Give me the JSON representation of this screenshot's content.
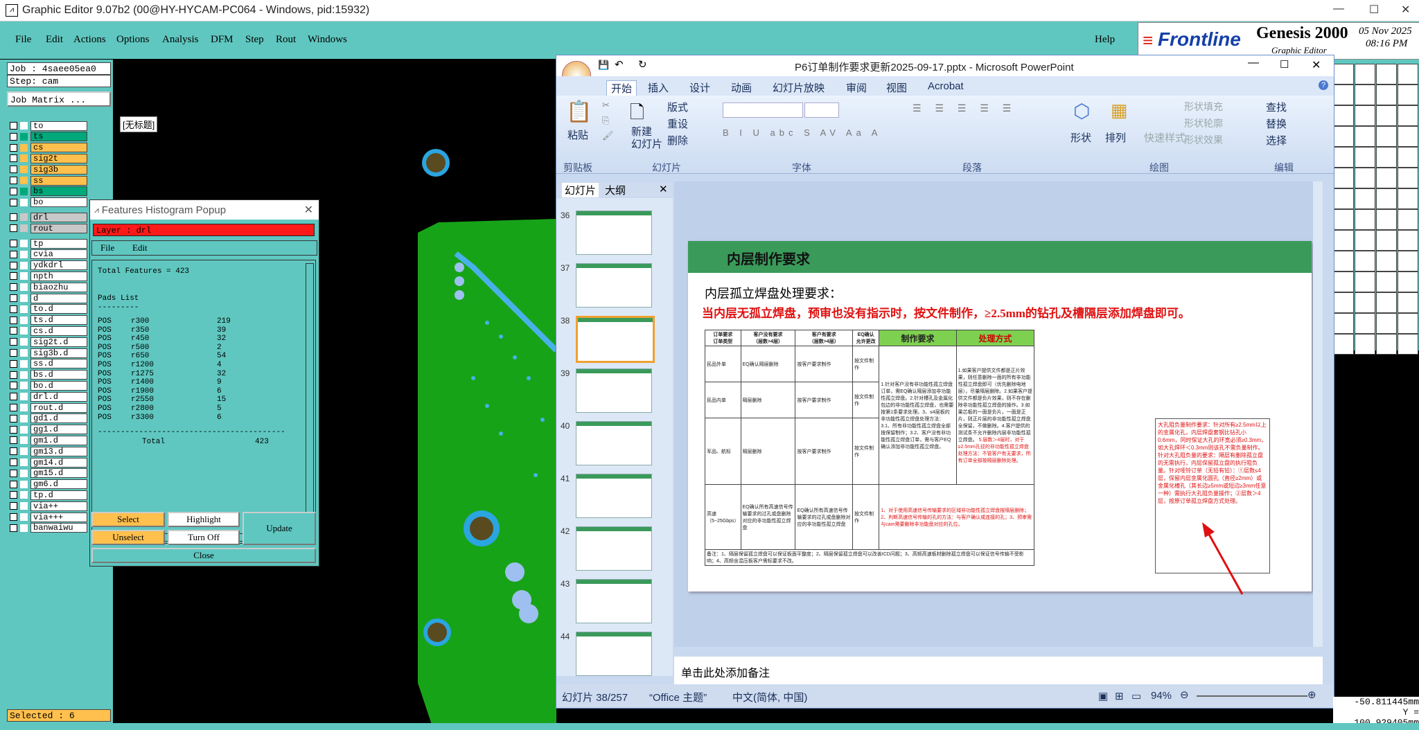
{
  "app": {
    "title": "Graphic Editor 9.07b2 (00@HY-HYCAM-PC064 - Windows, pid:15932)",
    "menus": [
      "File",
      "Edit",
      "Actions",
      "Options",
      "Analysis",
      "DFM",
      "Step",
      "Rout",
      "Windows"
    ],
    "help": "Help",
    "logo": {
      "brand": "Frontline",
      "product": "Genesis 2000",
      "subtitle": "Graphic Editor",
      "date": "05 Nov 2025",
      "time": "08:16 PM"
    }
  },
  "left_panel": {
    "job": "Job : 4saee05ea0",
    "step": "Step: cam",
    "job_matrix": "Job Matrix ...",
    "layers": [
      {
        "name": "to",
        "color": "#ffffff"
      },
      {
        "name": "ts",
        "color": "#00a87a"
      },
      {
        "name": "cs",
        "color": "#ffc04d"
      },
      {
        "name": "sig2t",
        "color": "#ffc04d"
      },
      {
        "name": "sig3b",
        "color": "#ffc04d"
      },
      {
        "name": "ss",
        "color": "#ffc04d"
      },
      {
        "name": "bs",
        "color": "#00a87a"
      },
      {
        "name": "bo",
        "color": "#ffffff"
      },
      {
        "name": "drl",
        "color": "#c8c8c8"
      },
      {
        "name": "rout",
        "color": "#c8c8c8"
      },
      {
        "name": "tp",
        "color": "#ffffff"
      },
      {
        "name": "cvia",
        "color": "#ffffff"
      },
      {
        "name": "ydkdrl",
        "color": "#ffffff"
      },
      {
        "name": "npth",
        "color": "#ffffff"
      },
      {
        "name": "biaozhu",
        "color": "#ffffff"
      },
      {
        "name": "d",
        "color": "#ffffff"
      },
      {
        "name": "to.d",
        "color": "#ffffff"
      },
      {
        "name": "ts.d",
        "color": "#ffffff"
      },
      {
        "name": "cs.d",
        "color": "#ffffff"
      },
      {
        "name": "sig2t.d",
        "color": "#ffffff"
      },
      {
        "name": "sig3b.d",
        "color": "#ffffff"
      },
      {
        "name": "ss.d",
        "color": "#ffffff"
      },
      {
        "name": "bs.d",
        "color": "#ffffff"
      },
      {
        "name": "bo.d",
        "color": "#ffffff"
      },
      {
        "name": "drl.d",
        "color": "#ffffff"
      },
      {
        "name": "rout.d",
        "color": "#ffffff"
      },
      {
        "name": "gd1.d",
        "color": "#ffffff"
      },
      {
        "name": "gg1.d",
        "color": "#ffffff"
      },
      {
        "name": "gm1.d",
        "color": "#ffffff"
      },
      {
        "name": "gm13.d",
        "color": "#ffffff"
      },
      {
        "name": "gm14.d",
        "color": "#ffffff"
      },
      {
        "name": "gm15.d",
        "color": "#ffffff"
      },
      {
        "name": "gm6.d",
        "color": "#ffffff"
      },
      {
        "name": "tp.d",
        "color": "#ffffff"
      },
      {
        "name": "via++",
        "color": "#ffffff"
      },
      {
        "name": "via+++",
        "color": "#ffffff"
      },
      {
        "name": "banwaiwu",
        "color": "#ffffff"
      }
    ],
    "selected": "Selected : 6"
  },
  "canvas": {
    "tag": "[无标题]"
  },
  "histogram": {
    "title": "Features Histogram Popup",
    "layer": "Layer :  drl",
    "menu": [
      "File",
      "Edit"
    ],
    "total_features": "Total Features = 423",
    "pads_list": "Pads List",
    "pads_sep": "---------",
    "rows": [
      [
        "POS",
        "r300",
        "219"
      ],
      [
        "POS",
        "r350",
        "39"
      ],
      [
        "POS",
        "r450",
        "32"
      ],
      [
        "POS",
        "r500",
        "2"
      ],
      [
        "POS",
        "r650",
        "54"
      ],
      [
        "POS",
        "r1200",
        "4"
      ],
      [
        "POS",
        "r1275",
        "32"
      ],
      [
        "POS",
        "r1400",
        "9"
      ],
      [
        "POS",
        "r1900",
        "6"
      ],
      [
        "POS",
        "r2550",
        "15"
      ],
      [
        "POS",
        "r2800",
        "5"
      ],
      [
        "POS",
        "r3300",
        "6"
      ]
    ],
    "total_label": "Total",
    "total": "423",
    "buttons": {
      "select": "Select",
      "highlight": "Highlight",
      "unselect": "Unselect",
      "turn_off": "Turn Off",
      "update": "Update",
      "close": "Close"
    }
  },
  "ppt": {
    "title": "P6订单制作要求更新2025-09-17.pptx - Microsoft PowerPoint",
    "tabs": [
      "开始",
      "插入",
      "设计",
      "动画",
      "幻灯片放映",
      "审阅",
      "视图",
      "Acrobat"
    ],
    "groups": [
      "剪贴板",
      "幻灯片",
      "字体",
      "段落",
      "绘图",
      "编辑"
    ],
    "ribbon": {
      "paste": "粘贴",
      "new_slide": "新建\n幻灯片",
      "layout": "版式",
      "reset": "重设",
      "delete": "删除",
      "shape": "形状",
      "arrange": "排列",
      "quick_style": "快速样式",
      "fill": "形状填充",
      "outline": "形状轮廓",
      "effect": "形状效果",
      "find": "查找",
      "replace": "替换",
      "select": "选择"
    },
    "pane_tabs": [
      "幻灯片",
      "大纲"
    ],
    "thumb_nums": [
      "36",
      "37",
      "38",
      "39",
      "40",
      "41",
      "42",
      "43",
      "44"
    ],
    "slide": {
      "header": "内层制作要求",
      "sub": "内层孤立焊盘处理要求：",
      "rule": "当内层无孤立焊盘，预审也没有指示时，按文件制作，≥2.5mm的钻孔及槽隔层添加焊盘即可。",
      "table_head": [
        "订单要求\n订单类型",
        "客户没有要求\n（层数>4层）",
        "客户有要求\n（层数>4层）",
        "EQ确认\n允许更改",
        "制作要求",
        "处理方式"
      ],
      "rows": [
        [
          "民品外单",
          "EQ确认隔层删除",
          "按客户要求制作",
          "按文件制作"
        ],
        [
          "民品内单",
          "隔层删除",
          "按客户要求制作",
          "按文件制作"
        ],
        [
          "军品、航标",
          "隔层删除",
          "按客户要求制作",
          "按文件制作"
        ],
        [
          "高速\n（5~25Gbps）",
          "EQ确认所有高速信号传输要求的过孔或盘删除对应的非功能性孤立焊盘",
          "EQ确认所有高速信号传输要求的过孔或盘删除对应的非功能性孤立焊盘",
          "按文件制作"
        ]
      ],
      "req_text": "1.针对客户没有非功能性孤立焊盘订单，需EQ确认隔层添加非功能性孤立焊盘。2.针对槽孔及金属化包边的非功能性孤立焊盘，也需要按第1条要求处理。3、≤4层板的非功能性孤立焊盘处理方法：3.1、所有非功能性孤立焊盘全部按保留制作；3.2、客户没有非功能性孤立焊盘订单，需与客户EQ确认添加非功能性孤立焊盘。",
      "method_text": "1.如果客户提供文件都是正片效果，则任意删除一面的所有非功能性孤立焊盘即可（优先删除电地层），尽量隔层删除。2.如果客户提供文件都是负片效果，则不存在删除非功能性孤立焊盘的操作。3.如果芯板的一面是负片，一面是正片，则正片层的非功能性孤立焊盘全保留，不做删除。4.客户提供的测试条不允许删除内层非功能性孤立焊盘。",
      "method_red": "5.层数＞4层时，对于≥2.5mm孔径的非功能性孤立焊盘处理方法：不管客户有无要求，所有订单全部按隔层删除处理。",
      "req_red": "1、对于使用高速信号传输要求的区域非功能性孤立焊盘按隔层删除；2、判断高速信号传输的孔的方法：与客户确认或连接的孔；3、预审需与cam需要删除非功能盘对应的孔位。",
      "note": "备注：1、隔层保留孤立焊盘可以保证板面平整度；2、隔层保留孤立焊盘可以改善ICD问题；3、高频高速板材删除孤立焊盘可以保证信号传输不受影响；4、高频含混压板客户需标要求不改。",
      "callout": "大孔阻负量制作要求：针对所有≥2.5mm以上的金属化孔，内层焊盘套钢比钻孔小0.6mm，同时保证大孔的环宽必须≥0.3mm，如大孔焊环＜0.3mm则该孔不需负量制作。针对大孔阻负量的要求：隔层有删除孤立盘的无需执行，内层保留孤立盘的执行阻负量。针对哑铃订单（无铅有铅）：①层数≤4层，保留内层金属化圆孔（直径≥2mm）或金属化槽孔（其长边≥5mm或短边≥3mm任意一种）需执行大孔阻负量操作；②层数＞4层，按原订单孤立焊盘方式处理。"
    },
    "notes": "单击此处添加备注",
    "status": {
      "slide": "幻灯片 38/257",
      "theme": "“Office 主题”",
      "lang": "中文(简体, 中国)",
      "zoom": "94%"
    }
  },
  "coords": {
    "x": "-50.811445mm",
    "y": "Y = 100.929405mm"
  }
}
